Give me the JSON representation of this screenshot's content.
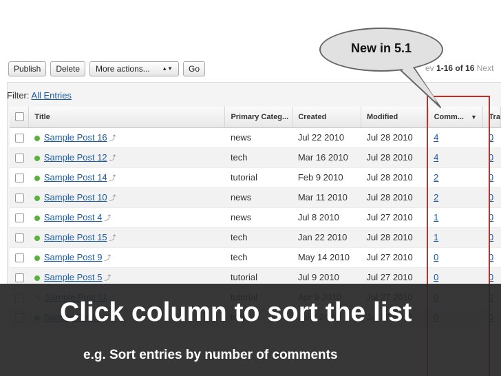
{
  "toolbar": {
    "publish_label": "Publish",
    "delete_label": "Delete",
    "actions_value": "More actions...",
    "go_label": "Go"
  },
  "pager": {
    "prev_label": "ev",
    "range": "1-16 of 16",
    "next_label": "Next"
  },
  "filter": {
    "label": "Filter:",
    "link": "All Entries"
  },
  "columns": {
    "title": "Title",
    "category": "Primary Categ...",
    "created": "Created",
    "modified": "Modified",
    "comments": "Comm...",
    "trackbacks": "Tra"
  },
  "rows": [
    {
      "title": "Sample Post 16",
      "category": "news",
      "created": "Jul 22 2010",
      "modified": "Jul 28 2010",
      "comments": "4",
      "trackbacks": "0",
      "status": "published"
    },
    {
      "title": "Sample Post 12",
      "category": "tech",
      "created": "Mar 16 2010",
      "modified": "Jul 28 2010",
      "comments": "4",
      "trackbacks": "0",
      "status": "published"
    },
    {
      "title": "Sample Post 14",
      "category": "tutorial",
      "created": "Feb 9 2010",
      "modified": "Jul 28 2010",
      "comments": "2",
      "trackbacks": "0",
      "status": "published"
    },
    {
      "title": "Sample Post 10",
      "category": "news",
      "created": "Mar 11 2010",
      "modified": "Jul 28 2010",
      "comments": "2",
      "trackbacks": "0",
      "status": "published"
    },
    {
      "title": "Sample Post 4",
      "category": "news",
      "created": "Jul 8 2010",
      "modified": "Jul 27 2010",
      "comments": "1",
      "trackbacks": "0",
      "status": "published"
    },
    {
      "title": "Sample Post 15",
      "category": "tech",
      "created": "Jan 22 2010",
      "modified": "Jul 28 2010",
      "comments": "1",
      "trackbacks": "0",
      "status": "published"
    },
    {
      "title": "Sample Post 9",
      "category": "tech",
      "created": "May 14 2010",
      "modified": "Jul 27 2010",
      "comments": "0",
      "trackbacks": "0",
      "status": "published"
    },
    {
      "title": "Sample Post 5",
      "category": "tutorial",
      "created": "Jul 9 2010",
      "modified": "Jul 27 2010",
      "comments": "0",
      "trackbacks": "0",
      "status": "published"
    },
    {
      "title": "Sample Post 11",
      "category": "tutorial",
      "created": "Apr 9 2010",
      "modified": "Jul 27 2010",
      "comments": "0",
      "trackbacks": "0",
      "status": "draft"
    },
    {
      "title": "Sample Post 1",
      "category": "tech",
      "created": "Jul 7 2010",
      "modified": "Jul 27 2010",
      "comments": "0",
      "trackbacks": "0",
      "status": "published"
    }
  ],
  "callout": {
    "text": "New in 5.1"
  },
  "overlay": {
    "caption": "Click column to sort the list",
    "subcaption": "e.g. Sort entries by number of comments"
  },
  "colors": {
    "link": "#1a5aa6",
    "highlight": "#d7261e",
    "status_ok": "#58b23b",
    "overlay": "#282828"
  }
}
